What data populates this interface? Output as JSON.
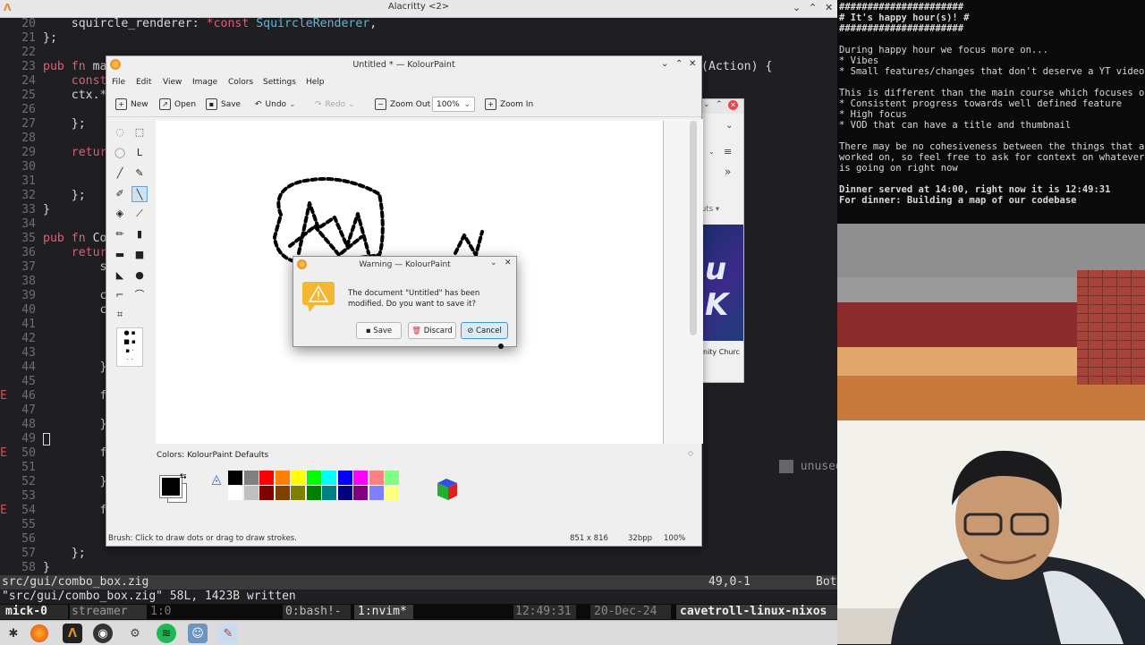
{
  "terminal": {
    "title": "Alacritty <2>",
    "lines": [
      {
        "n": "20",
        "text": "    squircle_renderer: *const SquircleRenderer,"
      },
      {
        "n": "21",
        "text": "};"
      },
      {
        "n": "22",
        "text": ""
      },
      {
        "n": "23",
        "text": "pub fn ma"
      },
      {
        "n": "24",
        "text": "    const"
      },
      {
        "n": "25",
        "text": "    ctx.*"
      },
      {
        "n": "26",
        "text": ""
      },
      {
        "n": "27",
        "text": "    };"
      },
      {
        "n": "28",
        "text": ""
      },
      {
        "n": "29",
        "text": "    retur"
      },
      {
        "n": "30",
        "text": ""
      },
      {
        "n": "31",
        "text": ""
      },
      {
        "n": "32",
        "text": "    };"
      },
      {
        "n": "33",
        "text": "}"
      },
      {
        "n": "34",
        "text": ""
      },
      {
        "n": "35",
        "text": "pub fn Co"
      },
      {
        "n": "36",
        "text": "    retur"
      },
      {
        "n": "37",
        "text": "        s"
      },
      {
        "n": "38",
        "text": ""
      },
      {
        "n": "39",
        "text": "        c"
      },
      {
        "n": "40",
        "text": "        c"
      },
      {
        "n": "41",
        "text": ""
      },
      {
        "n": "42",
        "text": ""
      },
      {
        "n": "43",
        "text": ""
      },
      {
        "n": "44",
        "text": "        }"
      },
      {
        "n": "45",
        "text": ""
      },
      {
        "n": "46",
        "text": "        f"
      },
      {
        "n": "47",
        "text": ""
      },
      {
        "n": "48",
        "text": "        }"
      },
      {
        "n": "49",
        "text": ""
      },
      {
        "n": "50",
        "text": "        f"
      },
      {
        "n": "51",
        "text": ""
      },
      {
        "n": "52",
        "text": "        }"
      },
      {
        "n": "53",
        "text": ""
      },
      {
        "n": "54",
        "text": "        f"
      },
      {
        "n": "55",
        "text": ""
      },
      {
        "n": "56",
        "text": ""
      },
      {
        "n": "57",
        "text": "    };"
      },
      {
        "n": "58",
        "text": "}"
      }
    ],
    "error_marker": "E",
    "partial_right_text": "(Action) {",
    "unused_hint": "unused f",
    "statusline": {
      "file": "src/gui/combo_box.zig",
      "pos": "49,0-1",
      "scroll": "Bot"
    },
    "cmdline": "\"src/gui/combo_box.zig\" 58L, 1423B written",
    "tmux": {
      "session": "mick-0",
      "streamer": "streamer",
      "win1": "1:0",
      "bash": "0:bash!-",
      "nvim": "1:nvim*",
      "time": "12:49:31",
      "date": "20-Dec-24",
      "host": "cavetroll-linux-nixos"
    }
  },
  "notes": {
    "lines": [
      "######################",
      "# It's happy hour(s)! #",
      "######################",
      "",
      "During happy hour we focus more on...",
      "* Vibes",
      "* Small features/changes that don't deserve a YT video",
      "",
      "This is different than the main course which focuses on",
      "* Consistent progress towards well defined feature",
      "* High focus",
      "* VOD that can have a title and thumbnail",
      "",
      "There may be no cohesiveness between the things that are",
      "worked on, so feel free to ask for context on whatever",
      "is going on right now",
      "",
      "Dinner served at 14:00, right now it is 12:49:31",
      "For dinner: Building a map of our codebase"
    ]
  },
  "bgwin": {
    "partial_label": "uts",
    "caption": "nity Churc"
  },
  "kolourpaint": {
    "title": "Untitled * — KolourPaint",
    "menus": [
      "File",
      "Edit",
      "View",
      "Image",
      "Colors",
      "Settings",
      "Help"
    ],
    "toolbar": {
      "new": "New",
      "open": "Open",
      "save": "Save",
      "undo": "Undo",
      "redo": "Redo",
      "zoom_out": "Zoom Out",
      "zoom_value": "100%",
      "zoom_in": "Zoom In"
    },
    "colors_label": "Colors: KolourPaint Defaults",
    "palette_top": [
      "#000000",
      "#808080",
      "#ff0000",
      "#ff8000",
      "#ffff00",
      "#00ff00",
      "#00ffff",
      "#0000ff",
      "#ff00ff",
      "#ff8080",
      "#80ff80"
    ],
    "palette_bottom": [
      "#ffffff",
      "#c0c0c0",
      "#800000",
      "#804000",
      "#808000",
      "#008000",
      "#008080",
      "#000080",
      "#800080",
      "#8080ff",
      "#ffff80"
    ],
    "status": {
      "hint": "Brush: Click to draw dots or drag to draw strokes.",
      "size": "851 x 816",
      "depth": "32bpp",
      "zoom": "100%"
    }
  },
  "dialog": {
    "title": "Warning — KolourPaint",
    "message": "The document \"Untitled\" has been modified. Do you want to save it?",
    "save": "Save",
    "discard": "Discard",
    "cancel": "Cancel"
  }
}
